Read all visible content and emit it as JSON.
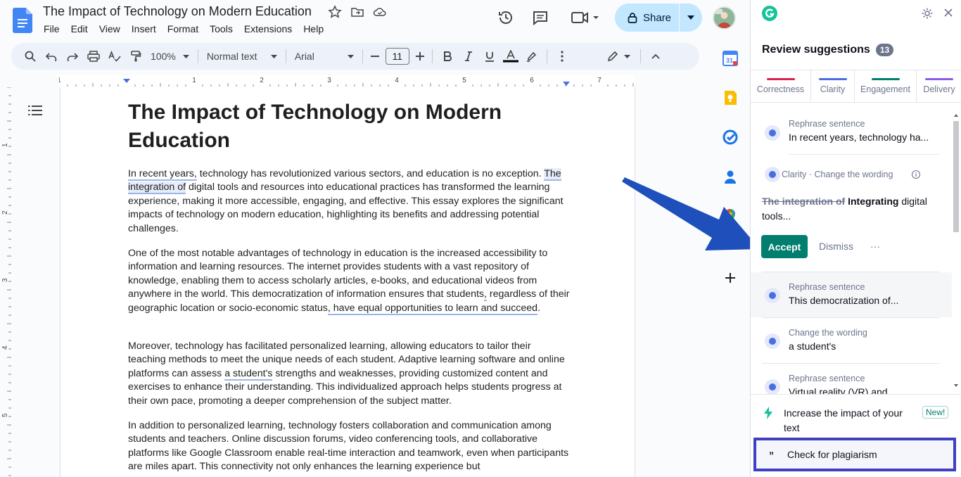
{
  "doc": {
    "title": "The Impact of Technology on Modern Education",
    "menu": [
      "File",
      "Edit",
      "View",
      "Insert",
      "Format",
      "Tools",
      "Extensions",
      "Help"
    ],
    "share_label": "Share"
  },
  "toolbar": {
    "zoom": "100%",
    "style": "Normal text",
    "font": "Arial",
    "font_size": "11"
  },
  "ruler": {
    "numbers": [
      "1",
      "1",
      "2",
      "3",
      "4",
      "5",
      "6",
      "7"
    ],
    "vnumbers": [
      "1",
      "2",
      "3",
      "4",
      "5"
    ]
  },
  "body": {
    "heading": "The Impact of Technology on Modern Education",
    "p1": {
      "a": "In recent years,",
      "b": " technology has revolutionized various sectors, and education is no exception. ",
      "c": "The integration of",
      "d": " digital tools and resources into educational practices has transformed the learning experience, making it more accessible, engaging, and effective. This essay explores the significant impacts of technology on modern education, highlighting its benefits and addressing potential challenges."
    },
    "p2": {
      "a": "One of the most notable advantages of technology in education is the increased accessibility to information and learning resources. The internet provides students with a vast repository of knowledge, enabling them to access scholarly articles, e-books, and educational videos from anywhere in the world. This democratization of information ensures that students",
      "b": ",",
      "c": " regardless of their geographic location or socio-economic status",
      "d": ", have equal opportunities to learn and succeed",
      "e": "."
    },
    "p3": {
      "a": "Moreover, technology has facilitated personalized learning, allowing educators to tailor their teaching methods to meet the unique needs of each student. Adaptive learning software and online platforms can assess ",
      "b": "a student's",
      "c": " strengths and weaknesses, providing customized content and exercises to enhance their understanding. This individualized approach helps students progress at their own pace, promoting a deeper comprehension of the subject matter."
    },
    "p4": "In addition to personalized learning, technology fosters collaboration and communication among students and teachers. Online discussion forums, video conferencing tools, and collaborative platforms like Google Classroom enable real-time interaction and teamwork, even when participants are miles apart. This connectivity not only enhances the learning experience but"
  },
  "grammarly": {
    "title": "Review suggestions",
    "count": "13",
    "tabs": [
      {
        "label": "Correctness",
        "color": "#d9214e"
      },
      {
        "label": "Clarity",
        "color": "#4a6ee0"
      },
      {
        "label": "Engagement",
        "color": "#027e6f"
      },
      {
        "label": "Delivery",
        "color": "#8c5ce6"
      }
    ],
    "cards": [
      {
        "kind": "Rephrase sentence",
        "text": "In recent years, technology ha..."
      },
      {
        "kind": "Clarity · Change the wording",
        "old": "The integration of",
        "new": "Integrating",
        "rest": " digital tools..."
      },
      {
        "kind": "Rephrase sentence",
        "text": "This democratization of..."
      },
      {
        "kind": "Change the wording",
        "text": "a student's"
      },
      {
        "kind": "Rephrase sentence",
        "text": "Virtual reality (VR) and..."
      }
    ],
    "accept": "Accept",
    "dismiss": "Dismiss",
    "more": "···",
    "impact": "Increase the impact of your text",
    "new_badge": "New!",
    "plagiarism": "Check for plagiarism",
    "quote_glyph": "”"
  },
  "side": {
    "calendar_day": "31"
  }
}
